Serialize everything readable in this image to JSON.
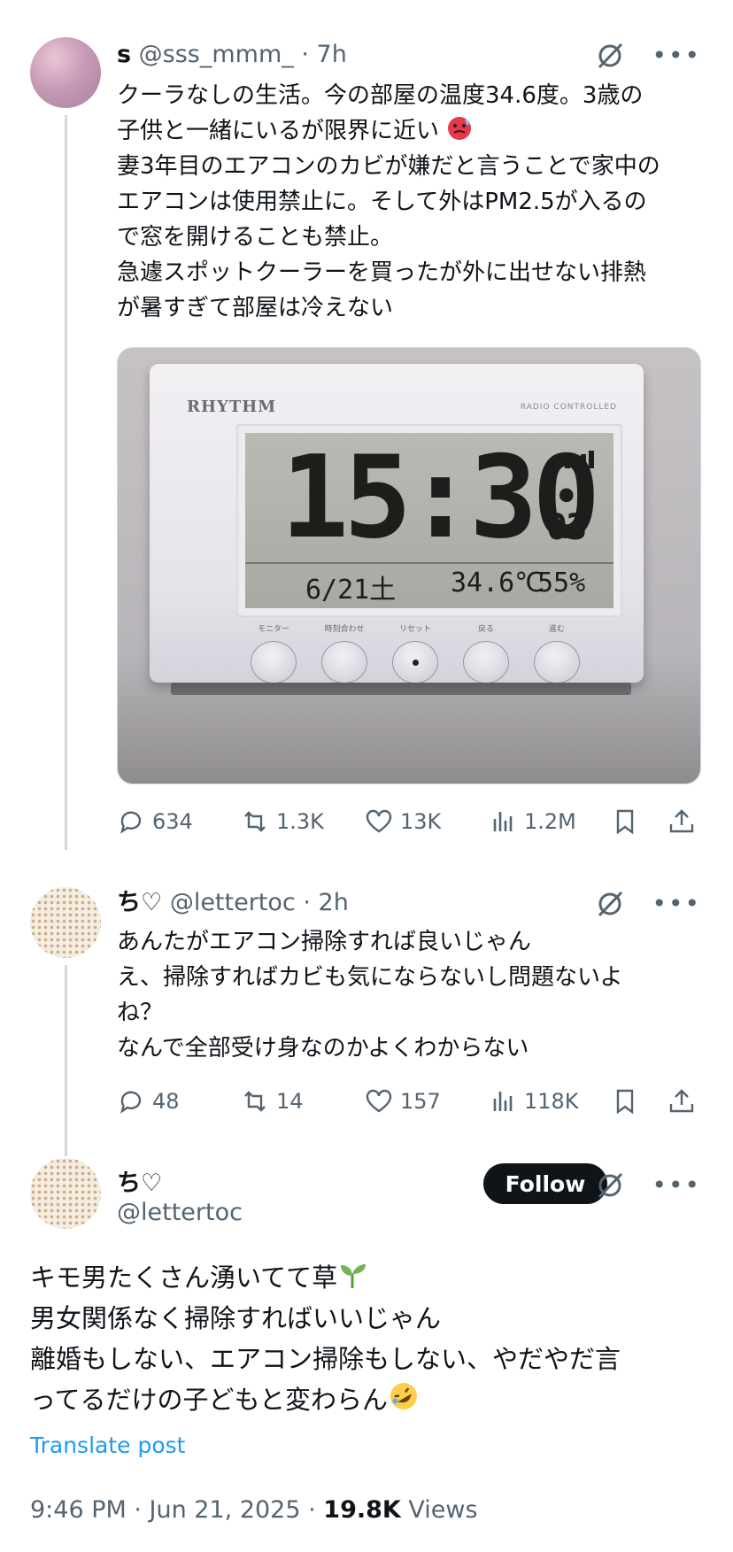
{
  "thread": [
    {
      "display_name": "s",
      "handle": "@sss_mmm_",
      "time": "· 7h",
      "lines": [
        "クーラなしの生活。今の部屋の温度34.6度。3歳の",
        "子供と一緒にいるが限界に近い",
        "妻3年目のエアコンのカビが嫌だと言うことで家中の",
        "エアコンは使用禁止に。そして外はPM2.5が入るの",
        "で窓を開けることも禁止。",
        "急遽スポットクーラーを買ったが外に出せない排熱",
        "が暑すぎて部屋は冷えない"
      ],
      "stats": {
        "replies": "634",
        "reposts": "1.3K",
        "likes": "13K",
        "views": "1.2M"
      },
      "photo": {
        "brand": "RHYTHM",
        "radio_label": "RADIO CONTROLLED",
        "time": "15:30",
        "seconds": "03",
        "date": "6/21土",
        "temperature": "34.6℃",
        "humidity": "55%",
        "buttons": [
          "モニター",
          "時刻合わせ",
          "リセット",
          "戻る",
          "進む"
        ]
      }
    },
    {
      "display_name": "ち♡",
      "handle": "@lettertoc",
      "time": "· 2h",
      "lines": [
        "あんたがエアコン掃除すれば良いじゃん",
        "え、掃除すればカビも気にならないし問題ないよ",
        "ね？",
        "なんで全部受け身なのかよくわからない"
      ],
      "stats": {
        "replies": "48",
        "reposts": "14",
        "likes": "157",
        "views": "118K"
      }
    }
  ],
  "main_post": {
    "display_name": "ち♡",
    "handle": "@lettertoc",
    "follow_label": "Follow",
    "lines": [
      "キモ男たくさん湧いてて草",
      "男女関係なく掃除すればいいじゃん",
      "離婚もしない、エアコン掃除もしない、やだやだ言",
      "ってるだけの子どもと変わらん"
    ],
    "translate_label": "Translate post",
    "timestamp": "9:46 PM · Jun 21, 2025 · ",
    "views_count": "19.8K",
    "views_label": " Views"
  },
  "icons": {
    "more": "more-horizontal-icon",
    "grok": "grok-icon",
    "reply": "reply-icon",
    "repost": "repost-icon",
    "like": "heart-icon",
    "views": "views-icon",
    "bookmark": "bookmark-icon",
    "share": "share-icon"
  },
  "colors": {
    "accent": "#1d9bf0",
    "text": "#0f1419",
    "muted": "#536471"
  }
}
